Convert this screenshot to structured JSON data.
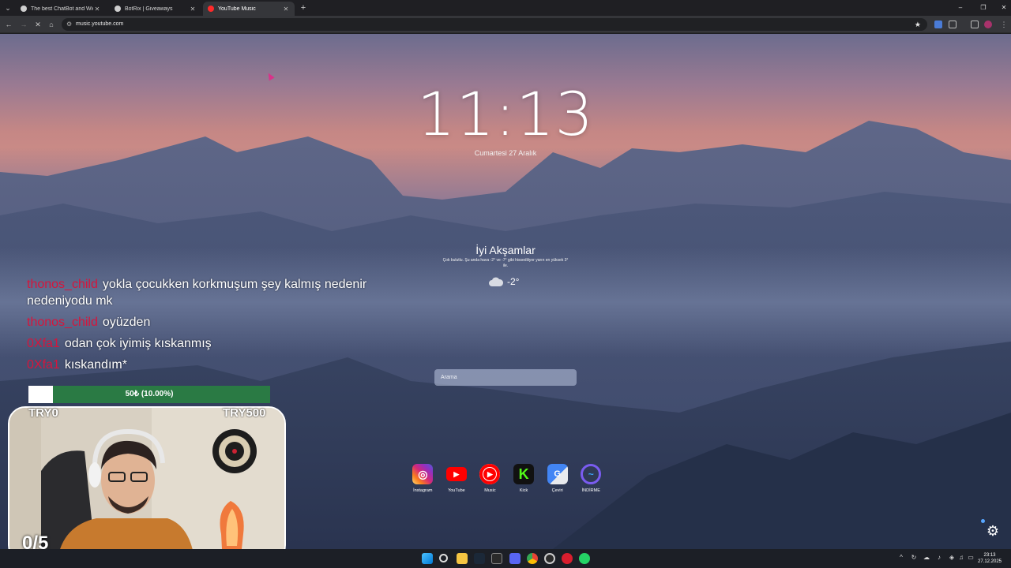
{
  "browser": {
    "tabs": [
      {
        "title": "The best ChatBot and Widgets",
        "active": false,
        "favicon_color": "#cfcfcf"
      },
      {
        "title": "BotRix | Giveaways",
        "active": false,
        "favicon_color": "#cfcfcf"
      },
      {
        "title": "YouTube Music",
        "active": true,
        "favicon_color": "#ff2a2a"
      }
    ],
    "new_tab_label": "+",
    "url": "music.youtube.com"
  },
  "startpage": {
    "time": "11:13",
    "date": "Cumartesi 27 Aralık",
    "greeting": "İyi Akşamlar",
    "weather_desc": "Çok bulutlu. Şu anda hava -2° ve -7° gibi hissediliyor yarın en yüksek 3° ile.",
    "temperature": "-2°",
    "weather_icon": "cloud-icon",
    "search_placeholder": "Arama",
    "shortcuts": [
      {
        "label": "İnstagram",
        "icon": "instagram-icon",
        "color": "#d6249f"
      },
      {
        "label": "YouTube",
        "icon": "youtube-icon",
        "color": "#ff0000"
      },
      {
        "label": "Music",
        "icon": "youtube-music-icon",
        "color": "#ff0000"
      },
      {
        "label": "Kick",
        "icon": "kick-icon",
        "color": "#53fc18"
      },
      {
        "label": "Çeviri",
        "icon": "translate-icon",
        "color": "#4285f4"
      },
      {
        "label": "İNDİRME",
        "icon": "download-icon",
        "color": "#3b6df0"
      }
    ]
  },
  "overlay": {
    "chat": [
      {
        "user": "thonos_child",
        "text": "yokla çocukken korkmuşum şey kalmış nedenir nedeniyodu mk"
      },
      {
        "user": "thonos_child",
        "text": "oyüzden"
      },
      {
        "user": "0Xfa1",
        "text": "odan çok iyimiş kıskanmış"
      },
      {
        "user": "0Xfa1",
        "text": "kıskandım*"
      }
    ],
    "goal": {
      "text": "50₺ (10.00%)",
      "progress": 0.1,
      "min_label": "TRY0",
      "max_label": "TRY500"
    },
    "counter": "0/5"
  },
  "taskbar": {
    "time": "23:13",
    "date": "27.12.2025"
  },
  "colors": {
    "chat_user": "#d6153c",
    "goal_bar": "#2a7a44",
    "accent": "#58a6ff"
  }
}
